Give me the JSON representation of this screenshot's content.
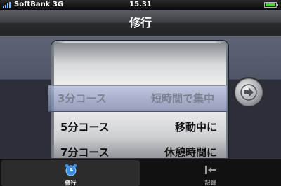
{
  "status_bar": {
    "carrier": "SoftBank",
    "network": "3G",
    "time": "15.31"
  },
  "nav": {
    "title": "修行"
  },
  "picker": {
    "rows": [
      {
        "course": "3分コース",
        "desc": "短時間で集中",
        "selected": true
      },
      {
        "course": "5分コース",
        "desc": "移動中に",
        "selected": false
      },
      {
        "course": "7分コース",
        "desc": "休憩時間に",
        "selected": false
      }
    ]
  },
  "tabs": [
    {
      "label": "修行",
      "icon": "alarm-clock-icon",
      "active": true
    },
    {
      "label": "記録",
      "icon": "arrow-bar-icon",
      "active": false
    }
  ],
  "colors": {
    "tab_icon_active": "#3b8de0",
    "go_arrow": "#4a4d53"
  }
}
